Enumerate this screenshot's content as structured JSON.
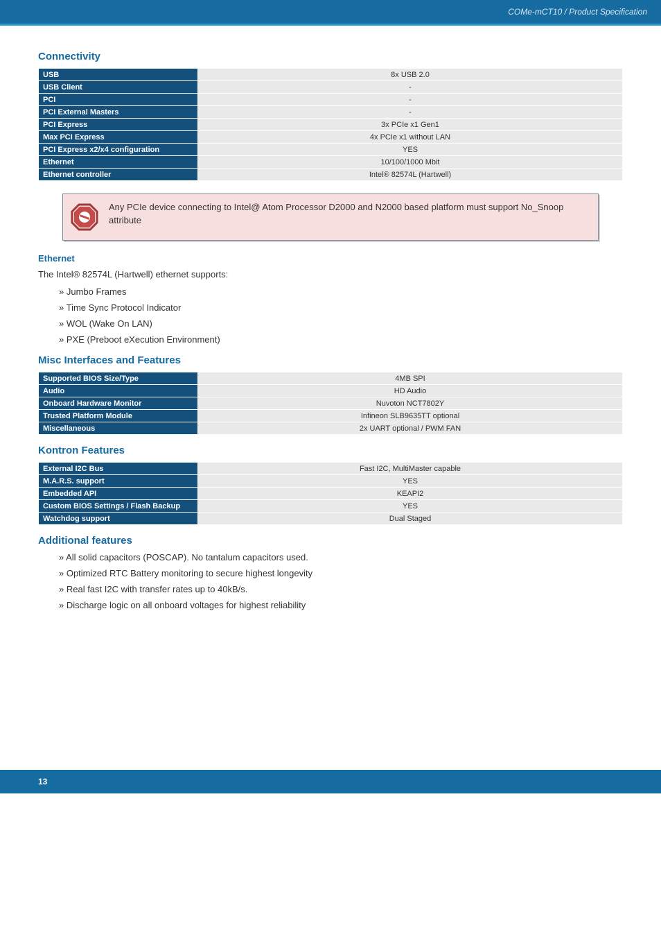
{
  "header": {
    "breadcrumb": "COMe-mCT10 / Product Specification"
  },
  "sections": {
    "connectivity": {
      "title": "Connectivity",
      "rows": [
        {
          "label": "USB",
          "value": "8x USB 2.0"
        },
        {
          "label": "USB Client",
          "value": "-"
        },
        {
          "label": "PCI",
          "value": "-"
        },
        {
          "label": "PCI External Masters",
          "value": "-"
        },
        {
          "label": "PCI Express",
          "value": "3x PCIe x1 Gen1"
        },
        {
          "label": "Max PCI Express",
          "value": "4x PCIe x1 without LAN"
        },
        {
          "label": "PCI Express x2/x4 configuration",
          "value": "YES"
        },
        {
          "label": "Ethernet",
          "value": "10/100/1000 Mbit"
        },
        {
          "label": "Ethernet controller",
          "value": "Intel® 82574L (Hartwell)"
        }
      ]
    },
    "callout": {
      "text": "Any PCIe device connecting to Intel@ Atom Processor D2000 and N2000 based platform must support No_Snoop attribute"
    },
    "ethernet": {
      "title": "Ethernet",
      "intro": "The Intel® 82574L (Hartwell) ethernet supports:",
      "items": [
        "Jumbo Frames",
        "Time Sync Protocol Indicator",
        "WOL (Wake On LAN)",
        "PXE (Preboot eXecution Environment)"
      ]
    },
    "misc": {
      "title": "Misc Interfaces and Features",
      "rows": [
        {
          "label": "Supported BIOS Size/Type",
          "value": "4MB SPI"
        },
        {
          "label": "Audio",
          "value": "HD Audio"
        },
        {
          "label": "Onboard Hardware Monitor",
          "value": "Nuvoton NCT7802Y"
        },
        {
          "label": "Trusted Platform Module",
          "value": "Infineon SLB9635TT optional"
        },
        {
          "label": "Miscellaneous",
          "value": "2x UART optional / PWM FAN"
        }
      ]
    },
    "kontron": {
      "title": "Kontron Features",
      "rows": [
        {
          "label": "External I2C Bus",
          "value": "Fast I2C, MultiMaster capable"
        },
        {
          "label": "M.A.R.S. support",
          "value": "YES"
        },
        {
          "label": "Embedded API",
          "value": "KEAPI2"
        },
        {
          "label": "Custom BIOS Settings / Flash Backup",
          "value": "YES"
        },
        {
          "label": "Watchdog support",
          "value": "Dual Staged"
        }
      ]
    },
    "additional": {
      "title": "Additional features",
      "items": [
        "All solid capacitors (POSCAP). No tantalum capacitors used.",
        "Optimized RTC Battery monitoring to secure highest longevity",
        "Real fast I2C with transfer rates up to 40kB/s.",
        "Discharge logic on all onboard voltages for highest reliability"
      ]
    }
  },
  "footer": {
    "page": "13"
  }
}
